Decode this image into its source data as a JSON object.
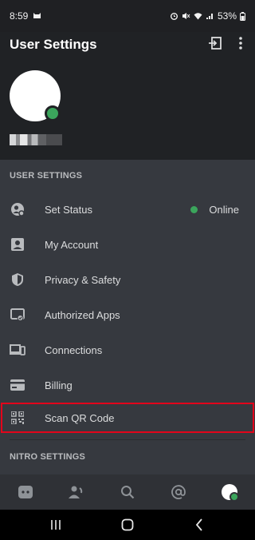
{
  "status_bar": {
    "time": "8:59",
    "battery": "53%"
  },
  "header": {
    "title": "User Settings"
  },
  "sections": {
    "user_settings_label": "USER SETTINGS",
    "nitro_settings_label": "NITRO SETTINGS"
  },
  "menu": [
    {
      "label": "Set Status",
      "icon": "set-status-icon",
      "value": "Online"
    },
    {
      "label": "My Account",
      "icon": "account-icon"
    },
    {
      "label": "Privacy & Safety",
      "icon": "shield-icon"
    },
    {
      "label": "Authorized Apps",
      "icon": "authorized-apps-icon"
    },
    {
      "label": "Connections",
      "icon": "connections-icon"
    },
    {
      "label": "Billing",
      "icon": "billing-icon"
    },
    {
      "label": "Scan QR Code",
      "icon": "qr-code-icon"
    }
  ],
  "tabs": [
    "home-tab",
    "friends-tab",
    "search-tab",
    "mentions-tab",
    "profile-tab"
  ],
  "colors": {
    "accent_online": "#3ba55c",
    "highlight": "#e3051b"
  }
}
